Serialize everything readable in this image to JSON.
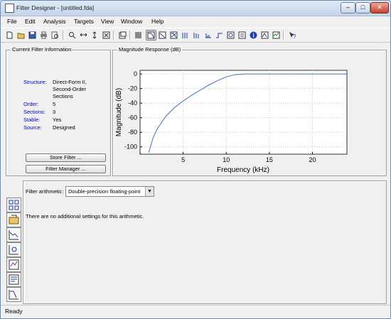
{
  "window": {
    "title": "Filter Designer - [untitled.fda]",
    "controls": [
      "–",
      "□",
      "✕"
    ]
  },
  "menu": [
    "File",
    "Edit",
    "Analysis",
    "Targets",
    "View",
    "Window",
    "Help"
  ],
  "toolbar": {
    "icons": [
      "new-file-icon",
      "open-folder-icon",
      "save-icon",
      "print-icon",
      "print-preview-icon",
      "zoom-in-icon",
      "zoom-x-icon",
      "zoom-y-icon",
      "full-view-icon",
      "new-figure-icon",
      "filter-spec-icon",
      "magnitude-response-icon",
      "phase-response-icon",
      "mag-phase-icon",
      "group-delay-icon",
      "phase-delay-icon",
      "impulse-response-icon",
      "step-response-icon",
      "pole-zero-icon",
      "filter-info-icon",
      "filter-coeffs-icon",
      "round-off-noise-icon",
      "whats-this-icon"
    ]
  },
  "filter_info": {
    "title": "Current Filter Information",
    "rows": [
      {
        "label": "Structure:",
        "value": "Direct-Form II, Second-Order Sections"
      },
      {
        "label": "Order:",
        "value": "5"
      },
      {
        "label": "Sections:",
        "value": "3"
      },
      {
        "label": "Stable:",
        "value": "Yes"
      },
      {
        "label": "Source:",
        "value": "Designed"
      }
    ],
    "store_button": "Store Filter ...",
    "manager_button": "Filter Manager ..."
  },
  "plot": {
    "panel_title": "Magnitude Response (dB)",
    "chart_data": {
      "type": "line",
      "title": "",
      "xlabel": "Frequency (kHz)",
      "ylabel": "Magnitude (dB)",
      "xlim": [
        0,
        24
      ],
      "ylim": [
        -110,
        5
      ],
      "xticks": [
        0,
        5,
        10,
        15,
        20
      ],
      "xtick_labels": [
        "",
        "5",
        "10",
        "15",
        "20"
      ],
      "yticks": [
        0,
        -20,
        -40,
        -60,
        -80,
        -100
      ],
      "grid": true,
      "series": [
        {
          "x": [
            1.0,
            1.5,
            2,
            3,
            4,
            5,
            6,
            7,
            8,
            9,
            10,
            11,
            12,
            12.5,
            13,
            24
          ],
          "y": [
            -108,
            -88,
            -75,
            -58,
            -46,
            -37,
            -29,
            -22,
            -15,
            -9,
            -4,
            -1,
            -0.1,
            0,
            0,
            0
          ]
        }
      ],
      "line_color": "#3d73b8"
    }
  },
  "arithmetic": {
    "label": "Filter arithmetic:",
    "selected": "Double-precision floating-point",
    "message": "There are no additional settings for this arithmetic."
  },
  "side_buttons": [
    "transform-filter-icon",
    "set-quantization-icon",
    "realize-model-icon",
    "pole-zero-editor-icon",
    "multirate-icon",
    "import-filter-icon",
    "design-filter-icon"
  ],
  "status": "Ready"
}
